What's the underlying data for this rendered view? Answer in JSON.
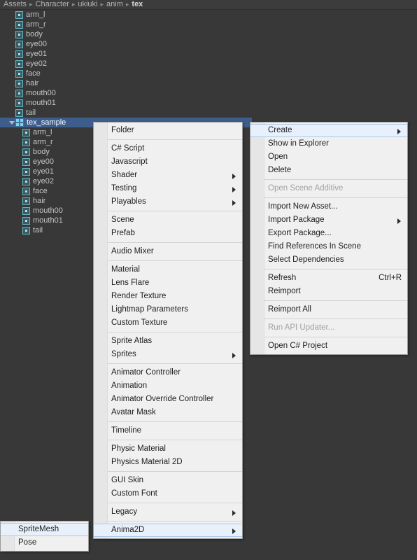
{
  "breadcrumb": {
    "separator": "▸",
    "items": [
      "Assets",
      "Character",
      "ukiuki",
      "anim",
      "tex"
    ]
  },
  "project_tree": {
    "root_items": [
      {
        "label": "arm_l",
        "icon": "sprite-icon"
      },
      {
        "label": "arm_r",
        "icon": "sprite-icon"
      },
      {
        "label": "body",
        "icon": "sprite-icon"
      },
      {
        "label": "eye00",
        "icon": "sprite-icon"
      },
      {
        "label": "eye01",
        "icon": "sprite-icon"
      },
      {
        "label": "eye02",
        "icon": "sprite-icon"
      },
      {
        "label": "face",
        "icon": "sprite-icon"
      },
      {
        "label": "hair",
        "icon": "sprite-icon"
      },
      {
        "label": "mouth00",
        "icon": "sprite-icon"
      },
      {
        "label": "mouth01",
        "icon": "sprite-icon"
      },
      {
        "label": "tail",
        "icon": "sprite-icon"
      }
    ],
    "selected_item": {
      "label": "tex_sample",
      "icon": "sprite-sheet-icon",
      "expanded": true,
      "selected": true
    },
    "child_items": [
      {
        "label": "arm_l",
        "icon": "sprite-icon"
      },
      {
        "label": "arm_r",
        "icon": "sprite-icon"
      },
      {
        "label": "body",
        "icon": "sprite-icon"
      },
      {
        "label": "eye00",
        "icon": "sprite-icon"
      },
      {
        "label": "eye01",
        "icon": "sprite-icon"
      },
      {
        "label": "eye02",
        "icon": "sprite-icon"
      },
      {
        "label": "face",
        "icon": "sprite-icon"
      },
      {
        "label": "hair",
        "icon": "sprite-icon"
      },
      {
        "label": "mouth00",
        "icon": "sprite-icon"
      },
      {
        "label": "mouth01",
        "icon": "sprite-icon"
      },
      {
        "label": "tail",
        "icon": "sprite-icon"
      }
    ]
  },
  "context_menu": {
    "items": [
      {
        "label": "Create",
        "submenu": true,
        "highlighted": true,
        "disabled": false
      },
      {
        "label": "Show in Explorer",
        "submenu": false,
        "highlighted": false,
        "disabled": false
      },
      {
        "label": "Open",
        "submenu": false,
        "highlighted": false,
        "disabled": false
      },
      {
        "label": "Delete",
        "submenu": false,
        "highlighted": false,
        "disabled": false
      },
      {
        "separator": true
      },
      {
        "label": "Open Scene Additive",
        "submenu": false,
        "highlighted": false,
        "disabled": true
      },
      {
        "separator": true
      },
      {
        "label": "Import New Asset...",
        "submenu": false,
        "highlighted": false,
        "disabled": false
      },
      {
        "label": "Import Package",
        "submenu": true,
        "highlighted": false,
        "disabled": false
      },
      {
        "label": "Export Package...",
        "submenu": false,
        "highlighted": false,
        "disabled": false
      },
      {
        "label": "Find References In Scene",
        "submenu": false,
        "highlighted": false,
        "disabled": false
      },
      {
        "label": "Select Dependencies",
        "submenu": false,
        "highlighted": false,
        "disabled": false
      },
      {
        "separator": true
      },
      {
        "label": "Refresh",
        "shortcut": "Ctrl+R",
        "submenu": false,
        "highlighted": false,
        "disabled": false
      },
      {
        "label": "Reimport",
        "submenu": false,
        "highlighted": false,
        "disabled": false
      },
      {
        "separator": true
      },
      {
        "label": "Reimport All",
        "submenu": false,
        "highlighted": false,
        "disabled": false
      },
      {
        "separator": true
      },
      {
        "label": "Run API Updater...",
        "submenu": false,
        "highlighted": false,
        "disabled": true
      },
      {
        "separator": true
      },
      {
        "label": "Open C# Project",
        "submenu": false,
        "highlighted": false,
        "disabled": false
      }
    ]
  },
  "create_menu": {
    "items": [
      {
        "label": "Folder",
        "submenu": false,
        "highlighted": false
      },
      {
        "separator": true
      },
      {
        "label": "C# Script",
        "submenu": false,
        "highlighted": false
      },
      {
        "label": "Javascript",
        "submenu": false,
        "highlighted": false
      },
      {
        "label": "Shader",
        "submenu": true,
        "highlighted": false
      },
      {
        "label": "Testing",
        "submenu": true,
        "highlighted": false
      },
      {
        "label": "Playables",
        "submenu": true,
        "highlighted": false
      },
      {
        "separator": true
      },
      {
        "label": "Scene",
        "submenu": false,
        "highlighted": false
      },
      {
        "label": "Prefab",
        "submenu": false,
        "highlighted": false
      },
      {
        "separator": true
      },
      {
        "label": "Audio Mixer",
        "submenu": false,
        "highlighted": false
      },
      {
        "separator": true
      },
      {
        "label": "Material",
        "submenu": false,
        "highlighted": false
      },
      {
        "label": "Lens Flare",
        "submenu": false,
        "highlighted": false
      },
      {
        "label": "Render Texture",
        "submenu": false,
        "highlighted": false
      },
      {
        "label": "Lightmap Parameters",
        "submenu": false,
        "highlighted": false
      },
      {
        "label": "Custom Texture",
        "submenu": false,
        "highlighted": false
      },
      {
        "separator": true
      },
      {
        "label": "Sprite Atlas",
        "submenu": false,
        "highlighted": false
      },
      {
        "label": "Sprites",
        "submenu": true,
        "highlighted": false
      },
      {
        "separator": true
      },
      {
        "label": "Animator Controller",
        "submenu": false,
        "highlighted": false
      },
      {
        "label": "Animation",
        "submenu": false,
        "highlighted": false
      },
      {
        "label": "Animator Override Controller",
        "submenu": false,
        "highlighted": false
      },
      {
        "label": "Avatar Mask",
        "submenu": false,
        "highlighted": false
      },
      {
        "separator": true
      },
      {
        "label": "Timeline",
        "submenu": false,
        "highlighted": false
      },
      {
        "separator": true
      },
      {
        "label": "Physic Material",
        "submenu": false,
        "highlighted": false
      },
      {
        "label": "Physics Material 2D",
        "submenu": false,
        "highlighted": false
      },
      {
        "separator": true
      },
      {
        "label": "GUI Skin",
        "submenu": false,
        "highlighted": false
      },
      {
        "label": "Custom Font",
        "submenu": false,
        "highlighted": false
      },
      {
        "separator": true
      },
      {
        "label": "Legacy",
        "submenu": true,
        "highlighted": false
      },
      {
        "separator": true
      },
      {
        "label": "Anima2D",
        "submenu": true,
        "highlighted": true
      }
    ]
  },
  "anima2d_menu": {
    "items": [
      {
        "label": "SpriteMesh",
        "submenu": false,
        "highlighted": true
      },
      {
        "label": "Pose",
        "submenu": false,
        "highlighted": false
      }
    ]
  },
  "colors": {
    "panel_background": "#383838",
    "breadcrumb_background": "#3c3c3c",
    "selection_blue": "#3d5e8c",
    "menu_background": "#f0f0f0",
    "menu_highlight": "#e8f1fb",
    "disabled_text": "#a2a2a2",
    "sprite_icon_outline": "#5fb7c4"
  }
}
